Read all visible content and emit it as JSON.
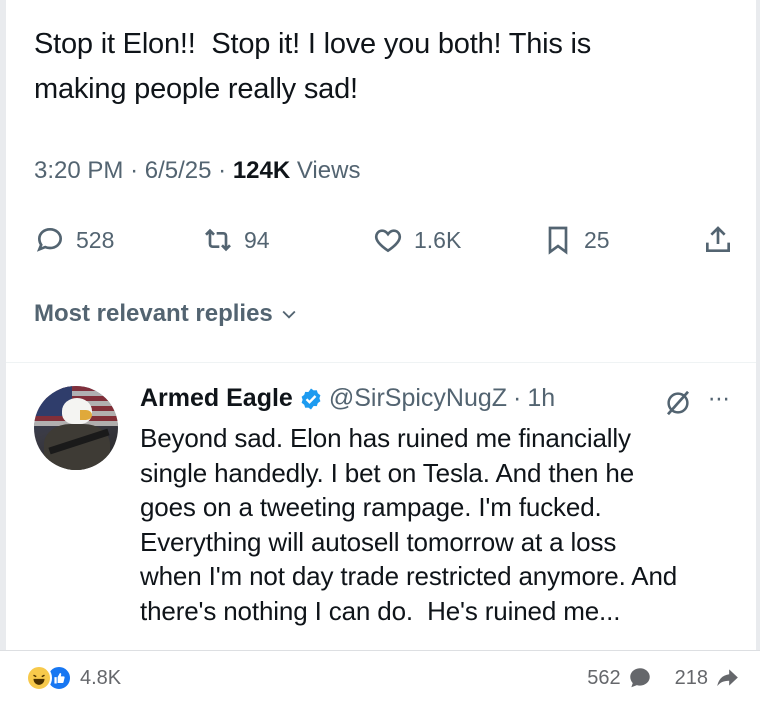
{
  "tweet": {
    "text_line1": "Stop it Elon!!  Stop it! I love you both! This is",
    "text_line2": "making people really sad!",
    "time": "3:20 PM",
    "date": "6/5/25",
    "views_count": "124K",
    "views_label": "Views"
  },
  "actions": {
    "reply_count": "528",
    "retweet_count": "94",
    "like_count": "1.6K",
    "bookmark_count": "25",
    "icons": [
      "reply-icon",
      "retweet-icon",
      "like-icon",
      "bookmark-icon",
      "share-icon"
    ]
  },
  "replies_filter": {
    "label": "Most relevant replies"
  },
  "reply": {
    "name": "Armed Eagle",
    "handle": "@SirSpicyNugZ",
    "time": "1h",
    "lines": [
      "Beyond sad. Elon has ruined me financially",
      "single handedly. I bet on Tesla. And then he",
      "goes on a tweeting rampage. I'm fucked.",
      "Everything will autosell tomorrow at a loss",
      "when I'm not day trade restricted anymore. And",
      "there's nothing I can do.  He's ruined me..."
    ]
  },
  "facebook": {
    "reaction_count": "4.8K",
    "comment_count": "562",
    "share_count": "218"
  },
  "colors": {
    "text": "#0f1419",
    "muted": "#536471",
    "verified": "#1d9bf0",
    "fb_blue": "#1877f2"
  }
}
